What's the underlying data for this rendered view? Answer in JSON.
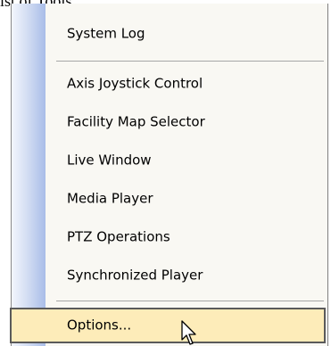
{
  "caption": "ist of Tools.",
  "menu": {
    "items": [
      {
        "label": "System Log"
      },
      {
        "label": "Axis Joystick Control"
      },
      {
        "label": "Facility Map Selector"
      },
      {
        "label": "Live Window"
      },
      {
        "label": "Media Player"
      },
      {
        "label": "PTZ Operations"
      },
      {
        "label": "Synchronized Player"
      },
      {
        "label": "Options..."
      }
    ],
    "selected_item": "Options...",
    "colors": {
      "highlight": "#fdecb9",
      "highlight_border": "#5a5a5a",
      "gutter": "#a9bde8",
      "menu_background": "#f9f8f3"
    }
  },
  "icons": {
    "cursor": "arrow-pointer-icon"
  }
}
